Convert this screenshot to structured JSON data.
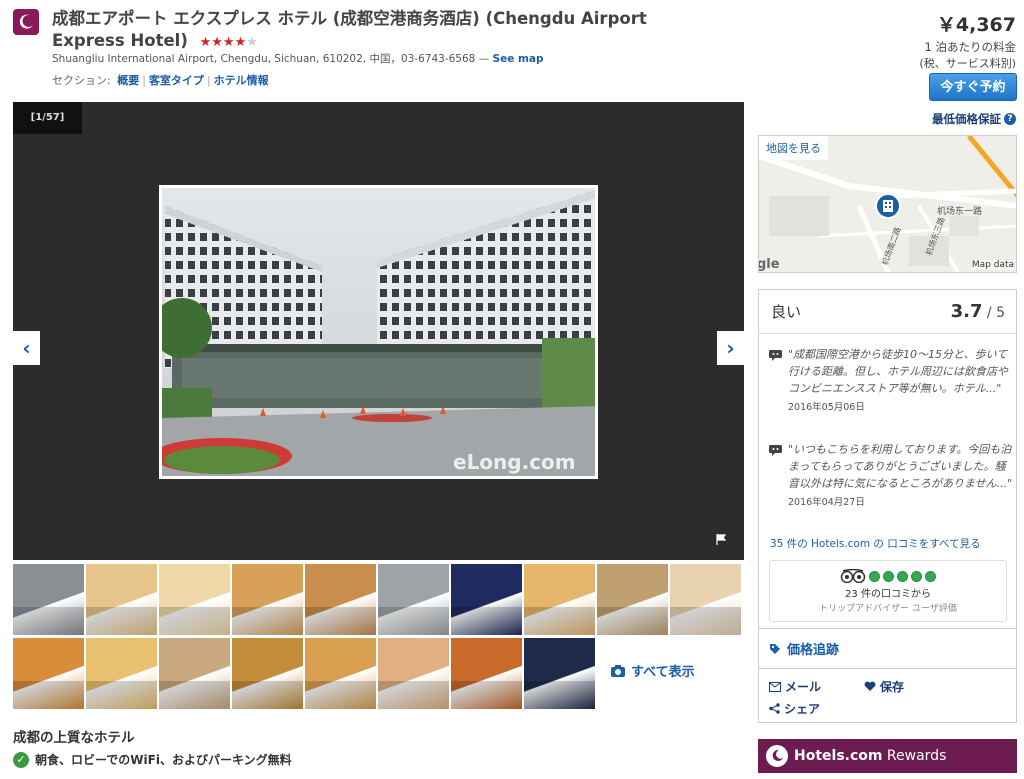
{
  "header": {
    "title": "成都エアポート エクスプレス ホテル (成都空港商务酒店) (Chengdu Airport Express Hotel)",
    "stars_on": "★★★★",
    "stars_off": "★",
    "address": "Shuangliu International Airport, Chengdu, Sichuan, 610202, 中国，03-6743-6568 — ",
    "see_map": "See map",
    "sections_label": "セクション:",
    "sections": [
      "概要",
      "客室タイプ",
      "ホテル情報"
    ]
  },
  "price": {
    "amount": "￥4,367",
    "per_night": "1 泊あたりの料金",
    "tax_note": "(税、サービス料別)",
    "book_label": "今すぐ予約",
    "guarantee": "最低価格保証",
    "guarantee_icon": "question-icon"
  },
  "gallery": {
    "counter": "[1/57]",
    "watermark": "eLong.com",
    "thumb_colors": [
      [
        "#8a8f94",
        "#e8c58a",
        "#f0d9a8",
        "#d9a05a",
        "#c98d4e",
        "#9ea3a8",
        "#1f2a5e",
        "#e6b56e",
        "#c0a070",
        "#e8d2b0"
      ],
      [
        "#d98c3a",
        "#e8c070",
        "#c9a880",
        "#c48d3c",
        "#d8a050",
        "#e0b080",
        "#c86a2a",
        "#1d2a4a"
      ]
    ],
    "show_all": "すべて表示"
  },
  "sections": {
    "best_hotels": "成都の上質なホテル",
    "amenity": "朝食、ロビーでのWiFi、およびパーキング無料"
  },
  "map": {
    "view_link": "地図を見る",
    "road_label_1": "机场东一路",
    "road_label_2": "机场东三路",
    "road_label_3": "机场南二路",
    "map_data": "Map data",
    "google_fragment": "gle"
  },
  "reviews": {
    "label": "良い",
    "score": "3.7",
    "out_of": " / 5",
    "items": [
      {
        "text": "\"成都国際空港から徒歩10～15分と、歩いて行ける距離。但し、ホテル周辺には飲食店やコンビニエンスストア等が無い。ホテル...\"",
        "date": "2016年05月06日"
      },
      {
        "text": "\"いつもこちらを利用しております。今回も泊まってもらってありがとうございました。騒音以外は特に気になるところがありません...\"",
        "date": "2016年04月27日"
      }
    ],
    "all_link": "35 件の Hotels.com の 口コミをすべて見る",
    "tripadvisor_count": "23 件の口コミから",
    "tripadvisor_sub": "トリップアドバイザー ユーザ評価",
    "tripadvisor_rating": 5
  },
  "tools": {
    "price_track": "価格追跡",
    "email": "メール",
    "save": "保存",
    "share": "シェア"
  },
  "rewards": {
    "label": "Hotels.com Rewards",
    "label_brand": "Hotels.com",
    "label_rest": " Rewards"
  }
}
